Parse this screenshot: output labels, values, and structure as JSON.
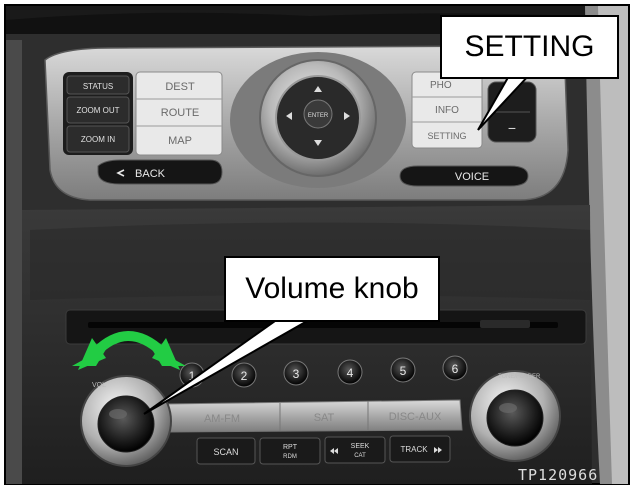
{
  "photo": {
    "callouts": {
      "setting": "SETTING",
      "volume": "Volume knob"
    },
    "image_id": "TP120966",
    "nav_buttons": {
      "status": "STATUS",
      "zoom_out": "ZOOM OUT",
      "zoom_in": "ZOOM IN",
      "dest": "DEST",
      "route": "ROUTE",
      "map": "MAP",
      "back": "BACK",
      "voice": "VOICE",
      "enter": "ENTER",
      "phone": "PHO",
      "info": "INFO",
      "setting": "SETTING"
    },
    "knob_labels": {
      "vol": "VOL",
      "tune": "TUNE/FOLDER"
    },
    "presets": [
      "1",
      "2",
      "3",
      "4",
      "5",
      "6"
    ],
    "audio_buttons": {
      "am_fm": "AM-FM",
      "sat": "SAT",
      "disc_aux": "DISC-AUX"
    },
    "lower_buttons": {
      "scan": "SCAN",
      "rpt": "RPT",
      "rdm": "RDM",
      "seek": "SEEK",
      "cat": "CAT",
      "track": "TRACK"
    },
    "colors": {
      "arrow": "#22cc44",
      "frame": "#000000",
      "callout_bg": "#ffffff"
    }
  }
}
